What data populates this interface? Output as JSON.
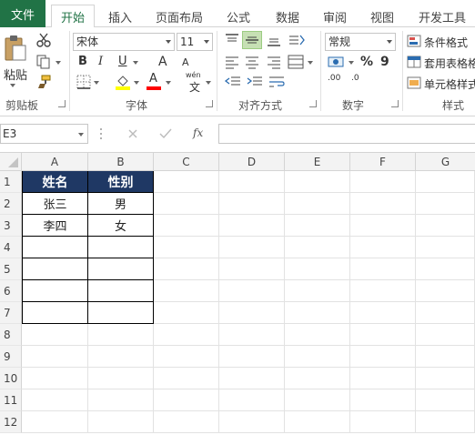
{
  "tabs": [
    "文件",
    "开始",
    "插入",
    "页面布局",
    "公式",
    "数据",
    "审阅",
    "视图",
    "开发工具"
  ],
  "active_tab": "开始",
  "ribbon": {
    "clipboard": {
      "paste_label": "粘贴",
      "group_label": "剪贴板"
    },
    "font": {
      "font_name": "宋体",
      "font_size": "11",
      "bold": "B",
      "italic": "I",
      "underline": "U",
      "grow": "A",
      "shrink": "A",
      "wen": "wén",
      "wen_char": "文",
      "font_color_letter": "A",
      "group_label": "字体"
    },
    "alignment": {
      "group_label": "对齐方式"
    },
    "number": {
      "format": "常规",
      "percent": "%",
      "comma": "9",
      "group_label": "数字",
      "inc_decimal": ".00",
      "dec_decimal": ".0"
    },
    "styles": {
      "conditional": "条件格式",
      "table_format": "套用表格格",
      "cell_styles": "单元格样式",
      "group_label": "样式"
    }
  },
  "formula_bar": {
    "name_box": "E3",
    "fx": "fx",
    "formula": ""
  },
  "columns": [
    "A",
    "B",
    "C",
    "D",
    "E",
    "F",
    "G"
  ],
  "rows": [
    "1",
    "2",
    "3",
    "4",
    "5",
    "6",
    "7",
    "8",
    "9",
    "10",
    "11",
    "12"
  ],
  "table": {
    "headers": [
      "姓名",
      "性别"
    ],
    "data": [
      [
        "张三",
        "男"
      ],
      [
        "李四",
        "女"
      ],
      [
        "",
        ""
      ],
      [
        "",
        ""
      ],
      [
        "",
        ""
      ],
      [
        "",
        ""
      ]
    ]
  },
  "colors": {
    "accent": "#217346",
    "header_fill": "#1f3864",
    "highlight": "#ffff00",
    "font_red": "#ff0000"
  }
}
